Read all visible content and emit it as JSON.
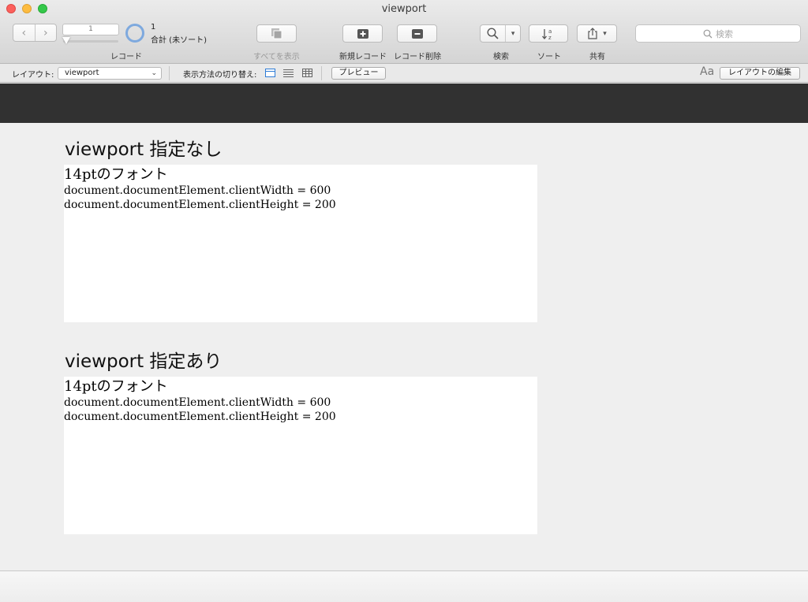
{
  "window": {
    "title": "viewport"
  },
  "toolbar": {
    "record_field_value": "1",
    "record_label": "レコード",
    "record_count": "1",
    "record_total": "合計 (未ソート)",
    "show_all_label": "すべてを表示",
    "new_record_label": "新規レコード",
    "delete_record_label": "レコード削除",
    "search_label": "検索",
    "sort_label": "ソート",
    "share_label": "共有",
    "search_placeholder": "検索"
  },
  "layoutbar": {
    "layout_label": "レイアウト:",
    "layout_value": "viewport",
    "view_switch_label": "表示方法の切り替え:",
    "preview_label": "プレビュー",
    "font_size_icon": "Aa",
    "edit_layout_label": "レイアウトの編集"
  },
  "sections": [
    {
      "title": "viewport 指定なし",
      "font_line": "14ptのフォント",
      "width_line": "document.documentElement.clientWidth = 600",
      "height_line": "document.documentElement.clientHeight = 200"
    },
    {
      "title": "viewport 指定あり",
      "font_line": "14ptのフォント",
      "width_line": "document.documentElement.clientWidth = 600",
      "height_line": "document.documentElement.clientHeight = 200"
    }
  ],
  "colors": {
    "accent": "#2e7cd6",
    "dark_band": "#313131",
    "progress_ring": "#7ea9de"
  }
}
